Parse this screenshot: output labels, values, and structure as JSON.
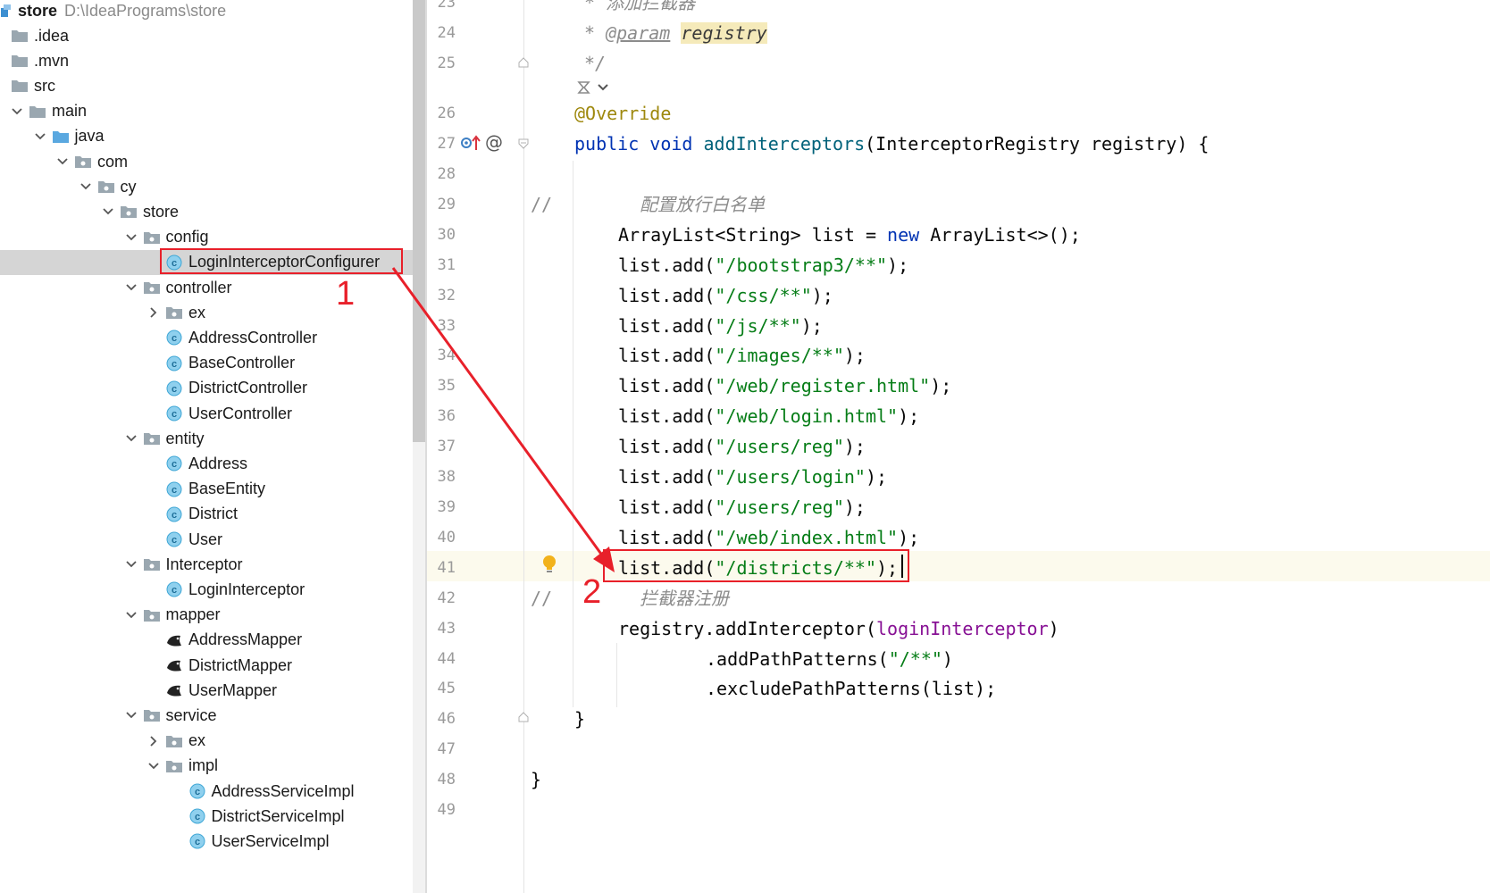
{
  "project_tree": {
    "root": {
      "name": "store",
      "path": "D:\\IdeaPrograms\\store"
    },
    "items": [
      {
        "label": ".idea",
        "kind": "folder",
        "depth": 0,
        "expanded": null
      },
      {
        "label": ".mvn",
        "kind": "folder",
        "depth": 0,
        "expanded": null
      },
      {
        "label": "src",
        "kind": "folder",
        "depth": 0,
        "expanded": null
      },
      {
        "label": "main",
        "kind": "folder",
        "depth": 1,
        "expanded": true
      },
      {
        "label": "java",
        "kind": "source-folder",
        "depth": 2,
        "expanded": true
      },
      {
        "label": "com",
        "kind": "package",
        "depth": 3,
        "expanded": true
      },
      {
        "label": "cy",
        "kind": "package",
        "depth": 4,
        "expanded": true
      },
      {
        "label": "store",
        "kind": "package",
        "depth": 5,
        "expanded": true
      },
      {
        "label": "config",
        "kind": "package",
        "depth": 6,
        "expanded": true
      },
      {
        "label": "LoginInterceptorConfigurer",
        "kind": "class",
        "depth": 7,
        "expanded": null,
        "selected": true
      },
      {
        "label": "controller",
        "kind": "package",
        "depth": 6,
        "expanded": true
      },
      {
        "label": "ex",
        "kind": "package",
        "depth": 7,
        "expanded": false
      },
      {
        "label": "AddressController",
        "kind": "class",
        "depth": 7,
        "expanded": null
      },
      {
        "label": "BaseController",
        "kind": "class",
        "depth": 7,
        "expanded": null
      },
      {
        "label": "DistrictController",
        "kind": "class",
        "depth": 7,
        "expanded": null
      },
      {
        "label": "UserController",
        "kind": "class",
        "depth": 7,
        "expanded": null
      },
      {
        "label": "entity",
        "kind": "package",
        "depth": 6,
        "expanded": true
      },
      {
        "label": "Address",
        "kind": "class",
        "depth": 7,
        "expanded": null
      },
      {
        "label": "BaseEntity",
        "kind": "class",
        "depth": 7,
        "expanded": null
      },
      {
        "label": "District",
        "kind": "class",
        "depth": 7,
        "expanded": null
      },
      {
        "label": "User",
        "kind": "class",
        "depth": 7,
        "expanded": null
      },
      {
        "label": "Interceptor",
        "kind": "package",
        "depth": 6,
        "expanded": true
      },
      {
        "label": "LoginInterceptor",
        "kind": "class",
        "depth": 7,
        "expanded": null
      },
      {
        "label": "mapper",
        "kind": "package",
        "depth": 6,
        "expanded": true
      },
      {
        "label": "AddressMapper",
        "kind": "mybatis",
        "depth": 7,
        "expanded": null
      },
      {
        "label": "DistrictMapper",
        "kind": "mybatis",
        "depth": 7,
        "expanded": null
      },
      {
        "label": "UserMapper",
        "kind": "mybatis",
        "depth": 7,
        "expanded": null
      },
      {
        "label": "service",
        "kind": "package",
        "depth": 6,
        "expanded": true
      },
      {
        "label": "ex",
        "kind": "package",
        "depth": 7,
        "expanded": false
      },
      {
        "label": "impl",
        "kind": "package",
        "depth": 7,
        "expanded": true
      },
      {
        "label": "AddressServiceImpl",
        "kind": "class",
        "depth": 8,
        "expanded": null
      },
      {
        "label": "DistrictServiceImpl",
        "kind": "class",
        "depth": 8,
        "expanded": null
      },
      {
        "label": "UserServiceImpl",
        "kind": "class",
        "depth": 8,
        "expanded": null
      }
    ]
  },
  "editor": {
    "current_line": 41,
    "lines": [
      {
        "n": "23",
        "indent": 1,
        "tokens": [
          [
            "cm",
            "* 添加拦截器"
          ]
        ]
      },
      {
        "n": "24",
        "indent": 1,
        "tokens": [
          [
            "cm",
            "* "
          ],
          [
            "doctag",
            "@param"
          ],
          [
            "cm",
            " "
          ],
          [
            "hl",
            "registry"
          ]
        ]
      },
      {
        "n": "25",
        "indent": 1,
        "tokens": [
          [
            "cm",
            "*/"
          ]
        ]
      },
      {
        "n": "",
        "indent": 0,
        "tokens": []
      },
      {
        "n": "26",
        "indent": 0,
        "tokens": [
          [
            "ann",
            "@Override"
          ]
        ]
      },
      {
        "n": "27",
        "indent": 0,
        "tokens": [
          [
            "kw",
            "public void "
          ],
          [
            "fn",
            "addInterceptors"
          ],
          [
            "",
            "(InterceptorRegistry registry) {"
          ]
        ]
      },
      {
        "n": "28",
        "indent": 0,
        "tokens": []
      },
      {
        "n": "29",
        "indent": 3,
        "comment_prefix": "//",
        "tokens": [
          [
            "cm",
            "配置放行白名单"
          ]
        ]
      },
      {
        "n": "30",
        "indent": 2,
        "tokens": [
          [
            "",
            "ArrayList<String> list = "
          ],
          [
            "kw",
            "new "
          ],
          [
            "",
            "ArrayList<>();"
          ]
        ]
      },
      {
        "n": "31",
        "indent": 2,
        "tokens": [
          [
            "",
            "list.add("
          ],
          [
            "str",
            "\"/bootstrap3/**\""
          ],
          [
            "",
            ");"
          ]
        ]
      },
      {
        "n": "32",
        "indent": 2,
        "tokens": [
          [
            "",
            "list.add("
          ],
          [
            "str",
            "\"/css/**\""
          ],
          [
            "",
            ");"
          ]
        ]
      },
      {
        "n": "33",
        "indent": 2,
        "tokens": [
          [
            "",
            "list.add("
          ],
          [
            "str",
            "\"/js/**\""
          ],
          [
            "",
            ");"
          ]
        ]
      },
      {
        "n": "34",
        "indent": 2,
        "tokens": [
          [
            "",
            "list.add("
          ],
          [
            "str",
            "\"/images/**\""
          ],
          [
            "",
            ");"
          ]
        ]
      },
      {
        "n": "35",
        "indent": 2,
        "tokens": [
          [
            "",
            "list.add("
          ],
          [
            "str",
            "\"/web/register.html\""
          ],
          [
            "",
            ");"
          ]
        ]
      },
      {
        "n": "36",
        "indent": 2,
        "tokens": [
          [
            "",
            "list.add("
          ],
          [
            "str",
            "\"/web/login.html\""
          ],
          [
            "",
            ");"
          ]
        ]
      },
      {
        "n": "37",
        "indent": 2,
        "tokens": [
          [
            "",
            "list.add("
          ],
          [
            "str",
            "\"/users/reg\""
          ],
          [
            "",
            ");"
          ]
        ]
      },
      {
        "n": "38",
        "indent": 2,
        "tokens": [
          [
            "",
            "list.add("
          ],
          [
            "str",
            "\"/users/login\""
          ],
          [
            "",
            ");"
          ]
        ]
      },
      {
        "n": "39",
        "indent": 2,
        "tokens": [
          [
            "",
            "list.add("
          ],
          [
            "str",
            "\"/users/reg\""
          ],
          [
            "",
            ");"
          ]
        ]
      },
      {
        "n": "40",
        "indent": 2,
        "tokens": [
          [
            "",
            "list.add("
          ],
          [
            "str",
            "\"/web/index.html\""
          ],
          [
            "",
            ");"
          ]
        ]
      },
      {
        "n": "41",
        "indent": 2,
        "tokens": [
          [
            "",
            "list.add("
          ],
          [
            "str",
            "\"/districts/**\""
          ],
          [
            "",
            ");"
          ]
        ]
      },
      {
        "n": "42",
        "indent": 3,
        "comment_prefix": "//",
        "tokens": [
          [
            "cm",
            "拦截器注册"
          ]
        ]
      },
      {
        "n": "43",
        "indent": 2,
        "tokens": [
          [
            "",
            "registry.addInterceptor("
          ],
          [
            "fld",
            "loginInterceptor"
          ],
          [
            "",
            ")"
          ]
        ]
      },
      {
        "n": "44",
        "indent": 6,
        "tokens": [
          [
            "",
            ".addPathPatterns("
          ],
          [
            "str",
            "\"/**\""
          ],
          [
            "",
            ")"
          ]
        ]
      },
      {
        "n": "45",
        "indent": 6,
        "tokens": [
          [
            "",
            ".excludePathPatterns(list);"
          ]
        ]
      },
      {
        "n": "46",
        "indent": 0,
        "tokens": [
          [
            "",
            "}"
          ]
        ]
      },
      {
        "n": "47",
        "indent": 0,
        "tokens": []
      },
      {
        "n": "48",
        "indent": -1,
        "tokens": [
          [
            "",
            "}"
          ]
        ]
      },
      {
        "n": "49",
        "indent": 0,
        "tokens": []
      }
    ]
  },
  "annotations": {
    "label_1": "1",
    "label_2": "2",
    "color": "#e8202a"
  },
  "colors": {
    "keyword": "#0033b3",
    "string": "#067d17",
    "annotation": "#9e880d",
    "field": "#871094",
    "method": "#00627a",
    "comment": "#8c8c8c",
    "current_line_bg": "#fcfaed",
    "class_icon": "#3fa7d6",
    "folder_icon": "#9aa7b0"
  }
}
